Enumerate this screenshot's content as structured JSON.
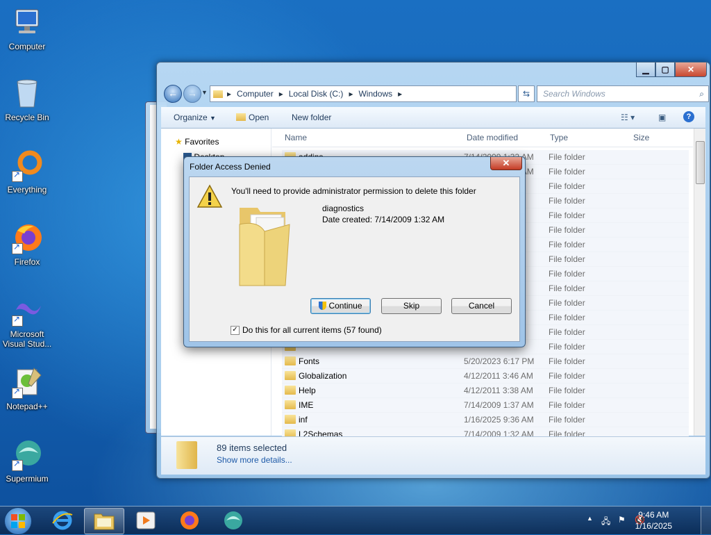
{
  "desktop": {
    "icons": [
      {
        "label": "Computer",
        "icon": "computer-icon"
      },
      {
        "label": "Recycle Bin",
        "icon": "recycle-bin-icon"
      },
      {
        "label": "Everything",
        "icon": "everything-icon"
      },
      {
        "label": "Firefox",
        "icon": "firefox-icon"
      },
      {
        "label": "Microsoft Visual Stud...",
        "icon": "visual-studio-icon"
      },
      {
        "label": "Notepad++",
        "icon": "notepadpp-icon"
      },
      {
        "label": "Supermium",
        "icon": "supermium-icon"
      }
    ]
  },
  "explorer": {
    "breadcrumb": [
      "Computer",
      "Local Disk (C:)",
      "Windows"
    ],
    "search_placeholder": "Search Windows",
    "toolbar": {
      "organize": "Organize",
      "open": "Open",
      "new_folder": "New folder"
    },
    "nav": {
      "favorites": "Favorites",
      "desktop": "Desktop"
    },
    "columns": {
      "name": "Name",
      "date": "Date modified",
      "type": "Type",
      "size": "Size"
    },
    "rows": [
      {
        "name": "addins",
        "date": "7/14/2009 1:32 AM",
        "type": "File folder"
      },
      {
        "name": "AppCompat",
        "date": "7/14/2009 1:32 AM",
        "type": "File folder"
      },
      {
        "name": "",
        "date": "",
        "type": "File folder"
      },
      {
        "name": "",
        "date": "",
        "type": "File folder"
      },
      {
        "name": "",
        "date": "",
        "type": "File folder"
      },
      {
        "name": "",
        "date": "",
        "type": "File folder"
      },
      {
        "name": "",
        "date": "",
        "type": "File folder"
      },
      {
        "name": "",
        "date": "",
        "type": "File folder"
      },
      {
        "name": "",
        "date": "",
        "type": "File folder"
      },
      {
        "name": "",
        "date": "",
        "type": "File folder"
      },
      {
        "name": "",
        "date": "",
        "type": "File folder"
      },
      {
        "name": "",
        "date": "",
        "type": "File folder"
      },
      {
        "name": "",
        "date": "",
        "type": "File folder"
      },
      {
        "name": "",
        "date": "",
        "type": "File folder"
      },
      {
        "name": "Fonts",
        "date": "5/20/2023 6:17 PM",
        "type": "File folder"
      },
      {
        "name": "Globalization",
        "date": "4/12/2011 3:46 AM",
        "type": "File folder"
      },
      {
        "name": "Help",
        "date": "4/12/2011 3:38 AM",
        "type": "File folder"
      },
      {
        "name": "IME",
        "date": "7/14/2009 1:37 AM",
        "type": "File folder"
      },
      {
        "name": "inf",
        "date": "1/16/2025 9:36 AM",
        "type": "File folder"
      },
      {
        "name": "L2Schemas",
        "date": "7/14/2009 1:32 AM",
        "type": "File folder"
      }
    ],
    "details": {
      "selected": "89 items selected",
      "more": "Show more details..."
    }
  },
  "dialog": {
    "title": "Folder Access Denied",
    "message": "You'll need to provide administrator permission to delete this folder",
    "item_name": "diagnostics",
    "item_date": "Date created: 7/14/2009 1:32 AM",
    "continue": "Continue",
    "skip": "Skip",
    "cancel": "Cancel",
    "checkbox": "Do this for all current items (57 found)",
    "checkbox_checked": true
  },
  "taskbar": {
    "time": "9:46 AM",
    "date": "1/16/2025"
  }
}
